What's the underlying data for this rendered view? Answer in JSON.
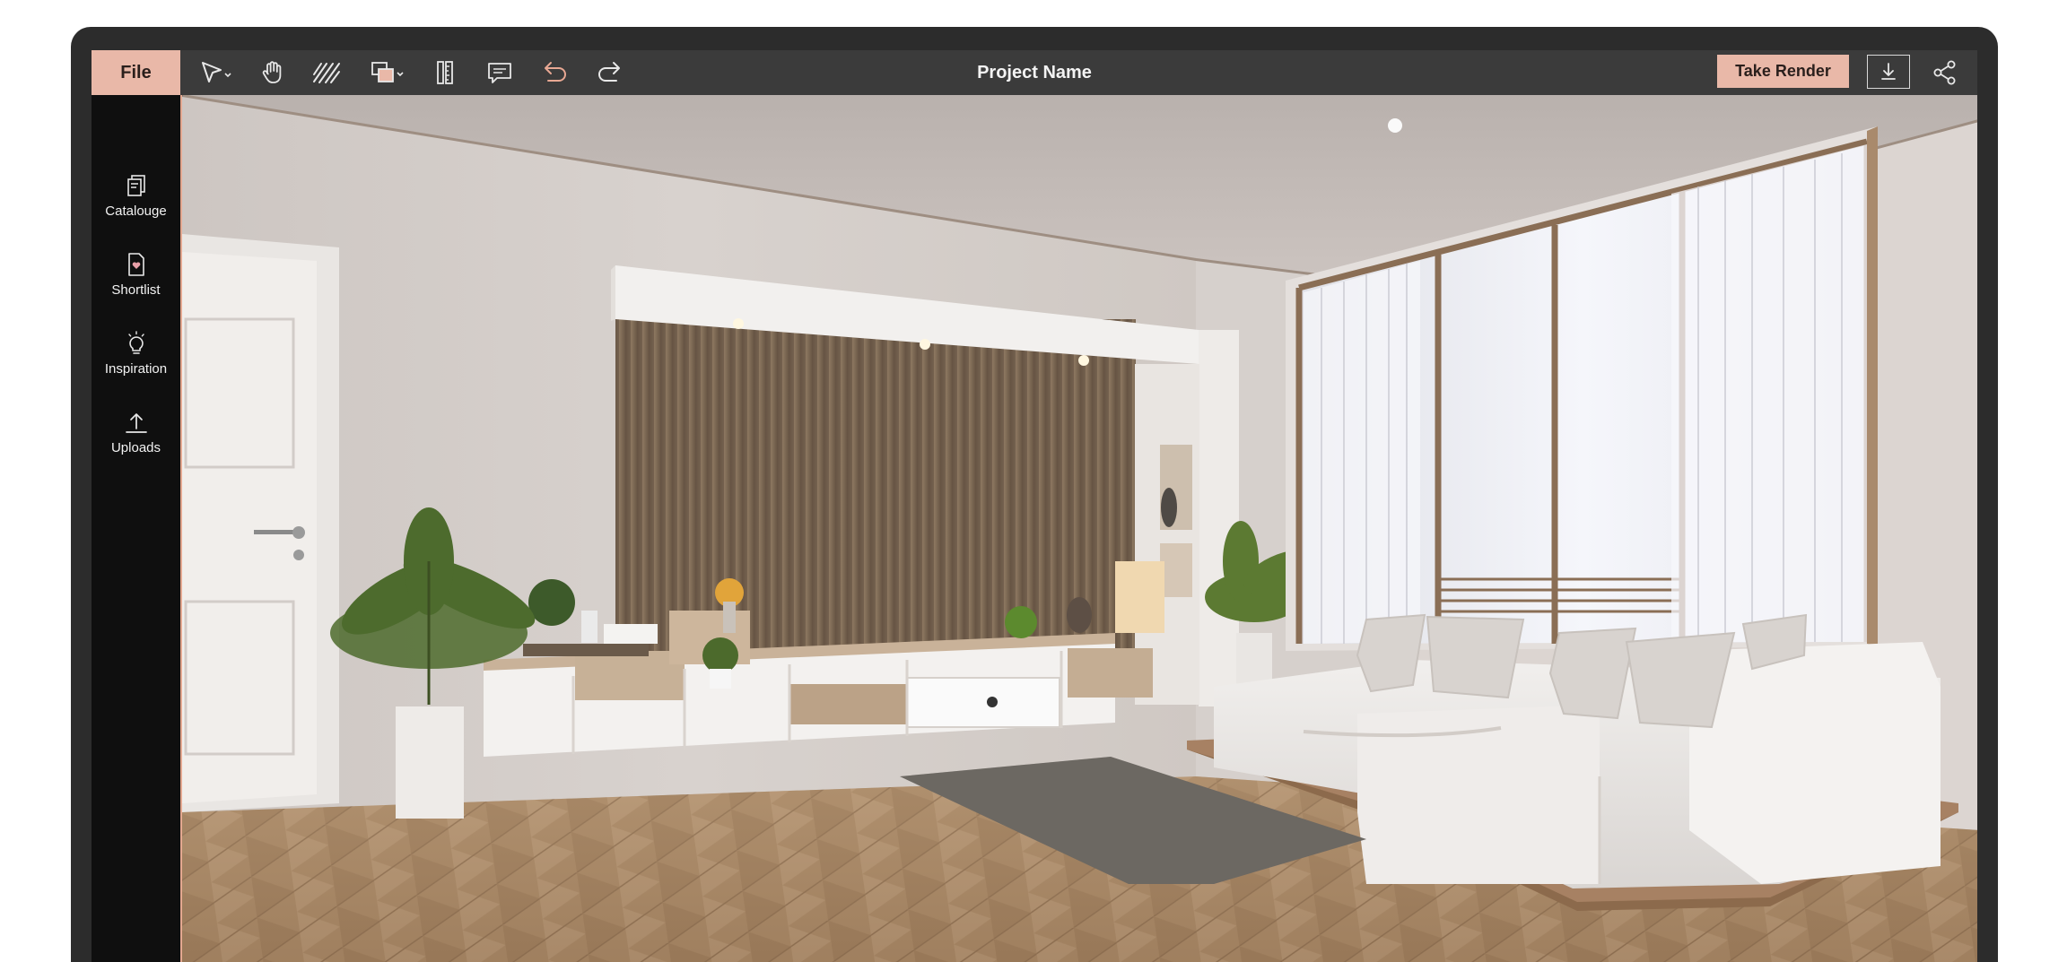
{
  "app": {
    "file_label": "File",
    "project_name": "Project Name",
    "render_label": "Take Render"
  },
  "toolbar": {
    "tools": [
      "select-pointer",
      "hand-pan",
      "hatch-pattern",
      "place-object",
      "measure-ruler",
      "comment",
      "undo",
      "redo"
    ]
  },
  "sidebar": {
    "items": [
      {
        "label": "Catalouge",
        "icon": "catalogue-icon"
      },
      {
        "label": "Shortlist",
        "icon": "shortlist-icon"
      },
      {
        "label": "Inspiration",
        "icon": "lightbulb-icon"
      },
      {
        "label": "Uploads",
        "icon": "upload-icon"
      }
    ]
  },
  "colors": {
    "accent": "#e9b8a8",
    "frame": "#2c2c2c",
    "toolbar": "#3b3b3b",
    "sidebar": "#0f0f0f"
  },
  "canvas": {
    "content": "living-room-render"
  }
}
